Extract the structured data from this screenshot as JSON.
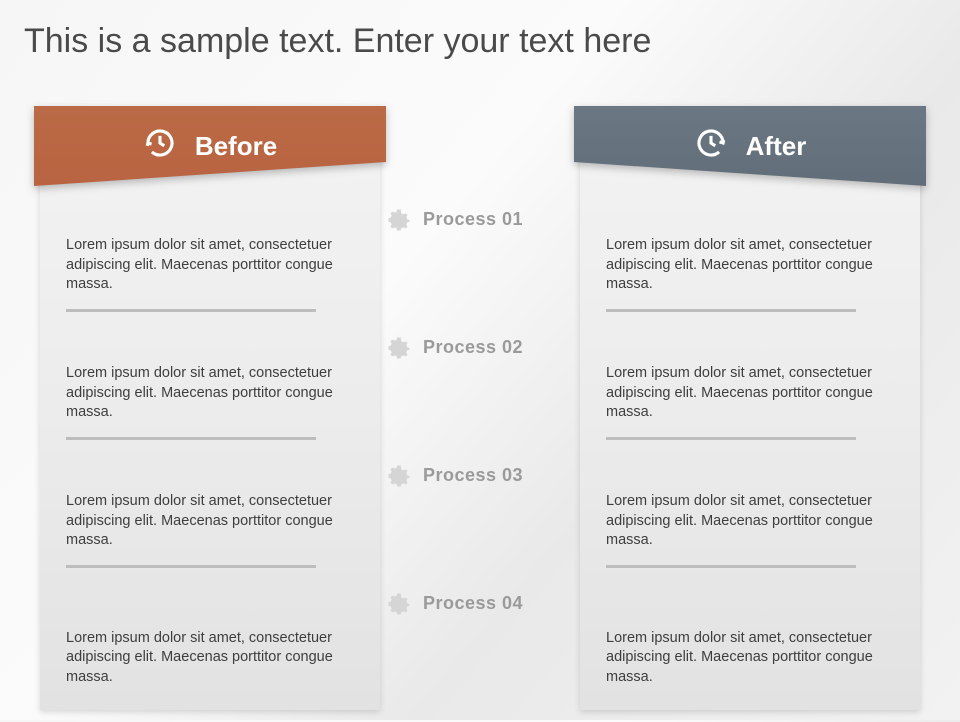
{
  "title": "This is a sample text. Enter your text here",
  "before": {
    "label": "Before",
    "items": [
      "Lorem ipsum dolor sit amet, consectetuer adipiscing elit. Maecenas porttitor congue massa.",
      "Lorem ipsum dolor sit amet, consectetuer adipiscing elit. Maecenas porttitor congue massa.",
      "Lorem ipsum dolor sit amet, consectetuer adipiscing elit. Maecenas porttitor congue massa.",
      "Lorem ipsum dolor sit amet, consectetuer adipiscing elit. Maecenas porttitor congue massa."
    ]
  },
  "after": {
    "label": "After",
    "items": [
      "Lorem ipsum dolor sit amet, consectetuer adipiscing elit. Maecenas porttitor congue massa.",
      "Lorem ipsum dolor sit amet, consectetuer adipiscing elit. Maecenas porttitor congue massa.",
      "Lorem ipsum dolor sit amet, consectetuer adipiscing elit. Maecenas porttitor congue massa.",
      "Lorem ipsum dolor sit amet, consectetuer adipiscing elit. Maecenas porttitor congue massa."
    ]
  },
  "processes": [
    "Process 01",
    "Process 02",
    "Process 03",
    "Process 04"
  ],
  "colors": {
    "before_header": "#b9643f",
    "after_header": "#65717c",
    "muted_text": "#9a9a9a"
  }
}
